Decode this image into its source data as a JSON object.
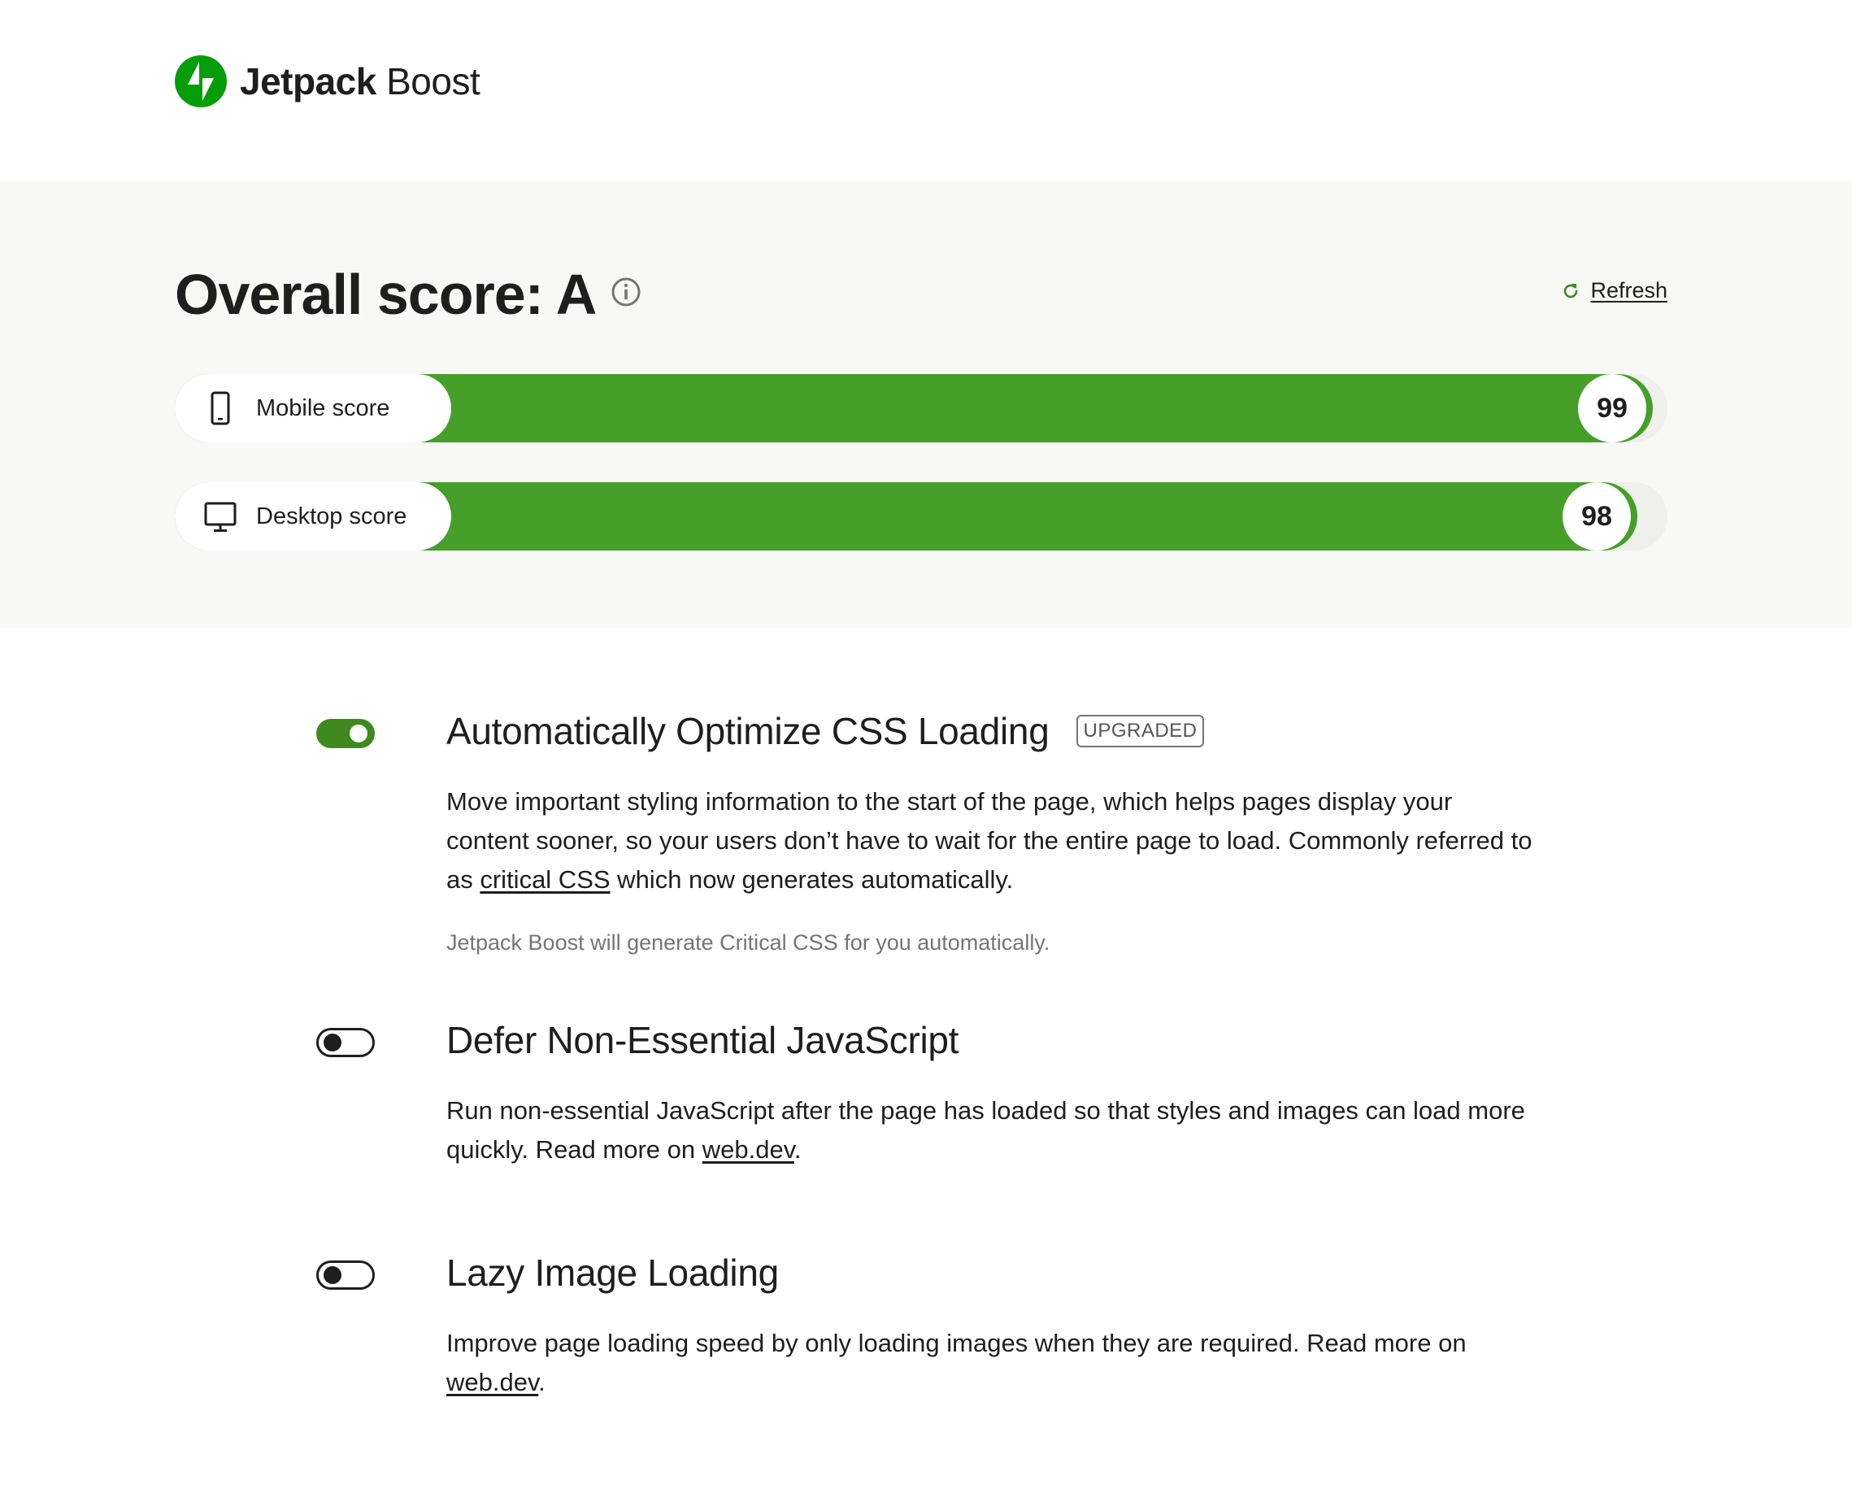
{
  "app": {
    "brand_bold": "Jetpack",
    "brand_light": "Boost"
  },
  "score": {
    "title": "Overall score: A",
    "refresh_label": "Refresh",
    "mobile": {
      "label": "Mobile score",
      "value": 99
    },
    "desktop": {
      "label": "Desktop score",
      "value": 98
    }
  },
  "modules": [
    {
      "title": "Automatically Optimize CSS Loading",
      "badge": "UPGRADED",
      "enabled": true,
      "desc_before": "Move important styling information to the start of the page, which helps pages display your content sooner, so your users don’t have to wait for the entire page to load. Commonly referred to as ",
      "link": "critical CSS",
      "desc_after": " which now generates automatically.",
      "note": "Jetpack Boost will generate Critical CSS for you automatically."
    },
    {
      "title": "Defer Non-Essential JavaScript",
      "enabled": false,
      "desc_before": "Run non-essential JavaScript after the page has loaded so that styles and images can load more quickly. Read more on ",
      "link": "web.dev",
      "desc_after": "."
    },
    {
      "title": "Lazy Image Loading",
      "enabled": false,
      "desc_before": "Improve page loading speed by only loading images when they are required. Read more on ",
      "link": "web.dev",
      "desc_after": "."
    }
  ],
  "colors": {
    "brand_green": "#069e08",
    "bar_green": "#459f28",
    "toggle_green": "#3e8a1f",
    "band_bg": "#f8f8f6"
  },
  "icons": {
    "logo": "jetpack-bolt-icon",
    "info": "info-icon",
    "refresh": "refresh-icon",
    "mobile": "smartphone-icon",
    "desktop": "monitor-icon"
  }
}
